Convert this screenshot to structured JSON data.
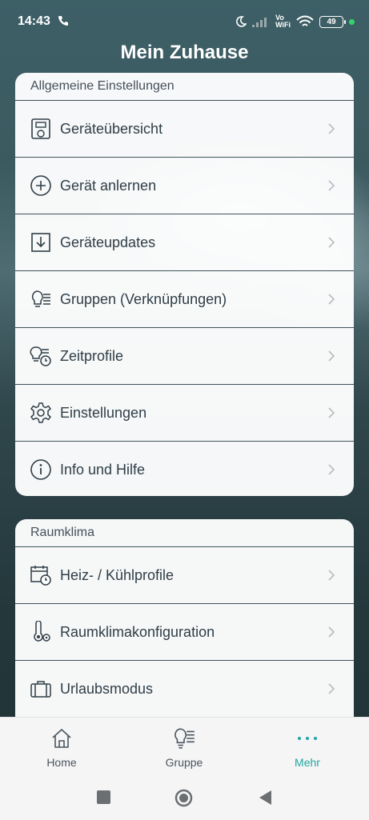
{
  "status": {
    "time": "14:43",
    "battery": "49",
    "network_label": "Vo\nWiFi"
  },
  "app": {
    "title": "Mein Zuhause"
  },
  "section_general": {
    "header": "Allgemeine Einstellungen",
    "items": [
      {
        "label": "Geräteübersicht",
        "icon": "device-overview-icon"
      },
      {
        "label": "Gerät anlernen",
        "icon": "plus-circle-icon"
      },
      {
        "label": "Geräteupdates",
        "icon": "download-icon"
      },
      {
        "label": "Gruppen (Verknüpfungen)",
        "icon": "lightbulb-group-icon"
      },
      {
        "label": "Zeitprofile",
        "icon": "time-profile-icon"
      },
      {
        "label": "Einstellungen",
        "icon": "gear-icon"
      },
      {
        "label": "Info und Hilfe",
        "icon": "info-icon"
      }
    ]
  },
  "section_climate": {
    "header": "Raumklima",
    "items": [
      {
        "label": "Heiz- / Kühlprofile",
        "icon": "calendar-clock-icon"
      },
      {
        "label": "Raumklimakonfiguration",
        "icon": "thermometer-gear-icon"
      },
      {
        "label": "Urlaubsmodus",
        "icon": "suitcase-icon"
      }
    ]
  },
  "bottom_nav": {
    "items": [
      {
        "label": "Home",
        "icon": "home-icon",
        "active": false
      },
      {
        "label": "Gruppe",
        "icon": "lightbulb-group-icon",
        "active": false
      },
      {
        "label": "Mehr",
        "icon": "more-dots-icon",
        "active": true
      }
    ]
  },
  "colors": {
    "accent": "#1fa6a2",
    "divider": "#3f5459",
    "text": "#2f3e47"
  }
}
